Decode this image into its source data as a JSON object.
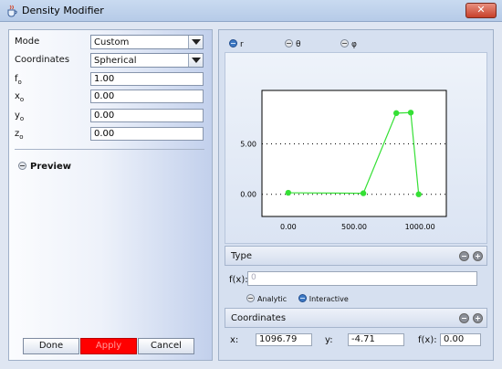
{
  "window": {
    "title": "Density Modifier",
    "close_label": "✕"
  },
  "left": {
    "mode": {
      "label": "Mode",
      "value": "Custom"
    },
    "coordinates": {
      "label": "Coordinates",
      "value": "Spherical"
    },
    "f0": {
      "label": "f",
      "sub": "o",
      "value": "1.00"
    },
    "x0": {
      "label": "x",
      "sub": "o",
      "value": "0.00"
    },
    "y0": {
      "label": "y",
      "sub": "o",
      "value": "0.00"
    },
    "z0": {
      "label": "z",
      "sub": "o",
      "value": "0.00"
    },
    "preview_label": "Preview",
    "buttons": {
      "done": "Done",
      "apply": "Apply",
      "cancel": "Cancel"
    }
  },
  "right": {
    "tabs": [
      {
        "label": "r",
        "selected": true
      },
      {
        "label": "θ",
        "selected": false
      },
      {
        "label": "φ",
        "selected": false
      }
    ],
    "type_section": {
      "title": "Type",
      "fx_label": "f(x):",
      "fx_placeholder": "0",
      "modes": [
        {
          "label": "Analytic",
          "selected": false
        },
        {
          "label": "Interactive",
          "selected": true
        }
      ]
    },
    "coordinates_section": {
      "title": "Coordinates",
      "x_label": "x:",
      "x_value": "1096.79",
      "y_label": "y:",
      "y_value": "-4.71",
      "fx_label": "f(x):",
      "fx_value": "0.00"
    }
  },
  "colors": {
    "series": "#35e035",
    "apply": "#ff0000"
  },
  "chart_data": {
    "type": "line",
    "x": [
      0,
      570,
      820,
      930,
      990
    ],
    "y": [
      0.15,
      0.1,
      8.05,
      8.1,
      0.0
    ],
    "xticks": [
      "0.00",
      "500.00",
      "1000.00"
    ],
    "yticks": [
      "0.00",
      "5.00"
    ],
    "xlim": [
      -200,
      1200
    ],
    "ylim": [
      -2.2,
      10.3
    ],
    "grid": "horizontal-dotted",
    "title": "",
    "xlabel": "",
    "ylabel": ""
  }
}
